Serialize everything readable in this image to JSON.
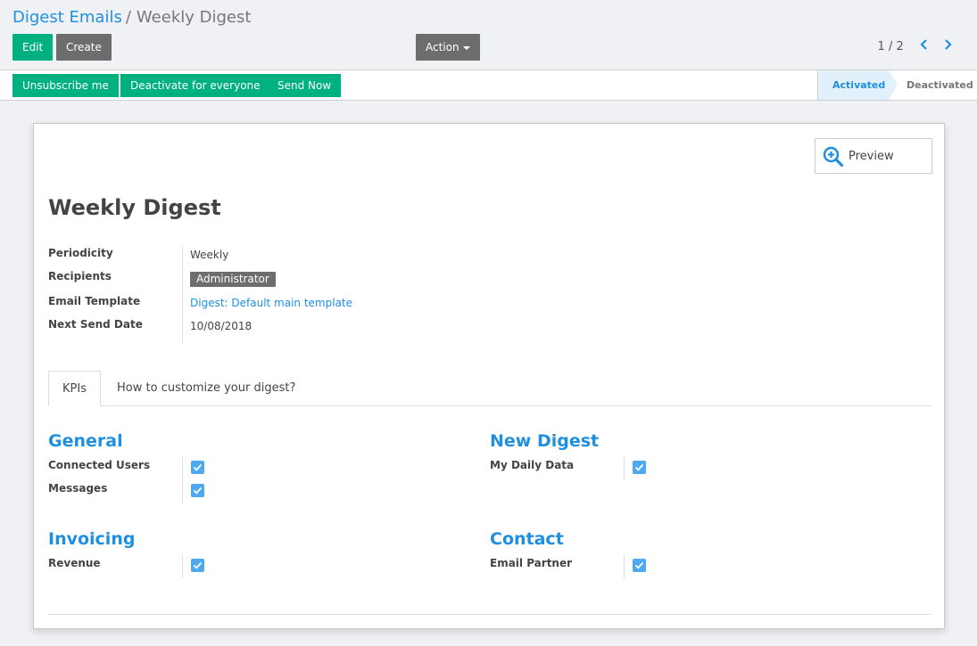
{
  "breadcrumb": {
    "parent": "Digest Emails",
    "separator": "/",
    "current": "Weekly Digest"
  },
  "toolbar": {
    "edit_label": "Edit",
    "create_label": "Create",
    "action_label": "Action"
  },
  "pager": {
    "value": "1 / 2"
  },
  "statusbar": {
    "buttons": [
      "Unsubscribe me",
      "Deactivate for everyone",
      "Send Now"
    ],
    "stages": [
      "Activated",
      "Deactivated"
    ],
    "active_stage": "Activated"
  },
  "preview": {
    "label": "Preview",
    "icon": "zoom-in-icon"
  },
  "record": {
    "title": "Weekly Digest",
    "fields": [
      {
        "label": "Periodicity",
        "value": "Weekly"
      },
      {
        "label": "Recipients",
        "value": "Administrator"
      },
      {
        "label": "Email Template",
        "value": "Digest: Default main template"
      },
      {
        "label": "Next Send Date",
        "value": "10/08/2018"
      }
    ]
  },
  "tabs": [
    "KPIs",
    "How to customize your digest?"
  ],
  "kpi_groups": [
    {
      "title": "General",
      "items": [
        {
          "label": "Connected Users",
          "checked": true
        },
        {
          "label": "Messages",
          "checked": true
        }
      ]
    },
    {
      "title": "New Digest",
      "items": [
        {
          "label": "My Daily Data",
          "checked": true
        }
      ]
    },
    {
      "title": "Invoicing",
      "items": [
        {
          "label": "Revenue",
          "checked": true
        }
      ]
    },
    {
      "title": "Contact",
      "items": [
        {
          "label": "Email Partner",
          "checked": true
        }
      ]
    }
  ],
  "colors": {
    "primary": "#00b180",
    "secondary": "#6d6d6d",
    "link": "#1f8fe0",
    "checkbox": "#4ea9f0",
    "stage_active_bg": "#e1f0fb"
  }
}
